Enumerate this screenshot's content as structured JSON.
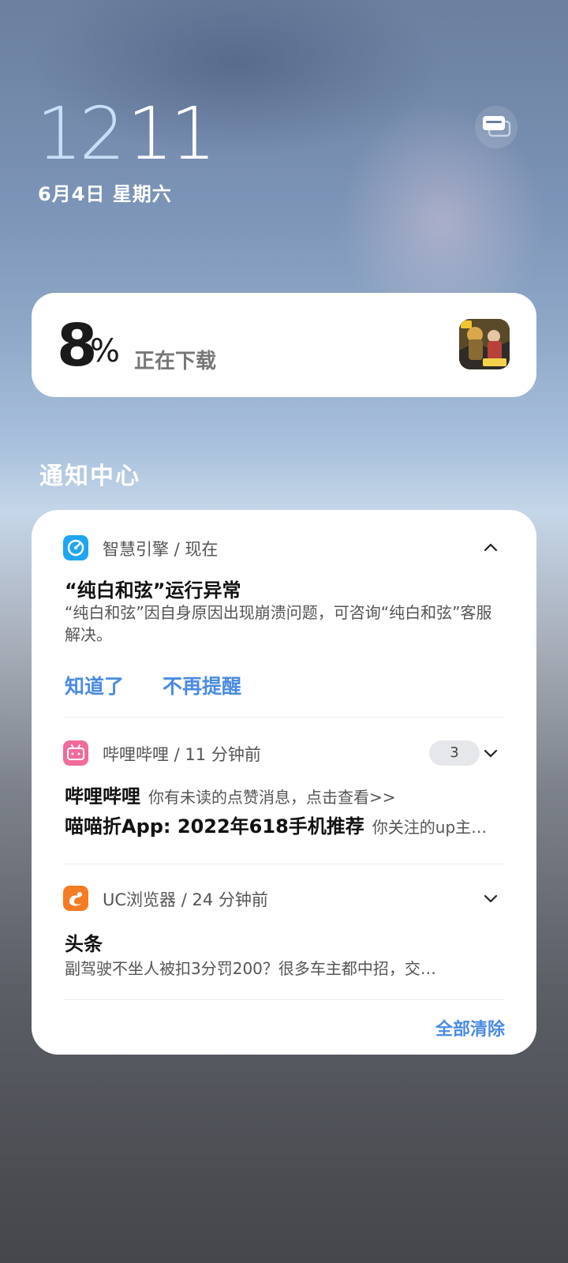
{
  "clock": {
    "hour": "12",
    "minute": "11"
  },
  "date": "6月4日 星期六",
  "download": {
    "percent": "8",
    "percent_sign": "%",
    "status": "正在下载"
  },
  "notification_center": {
    "title": "通知中心",
    "clear_all": "全部清除",
    "notifications": [
      {
        "app": "智慧引擎 / 现在",
        "title": "“纯白和弦”运行异常",
        "body": "“纯白和弦”因自身原因出现崩溃问题，可咨询“纯白和弦”客服解决。",
        "actions": [
          "知道了",
          "不再提醒"
        ]
      },
      {
        "app": "哔哩哔哩 / 11 分钟前",
        "count": "3",
        "lines": [
          {
            "title": "哔哩哔哩",
            "text": "你有未读的点赞消息，点击查看>>"
          },
          {
            "title": "喵喵折App: 2022年618手机推荐",
            "text": "你关注的up主…"
          }
        ]
      },
      {
        "app": "UC浏览器 / 24 分钟前",
        "title": "头条",
        "body": "副驾驶不坐人被扣3分罚200？很多车主都中招，交…"
      }
    ]
  },
  "colors": {
    "accent": "#4a8be0",
    "card": "#ffffff"
  }
}
